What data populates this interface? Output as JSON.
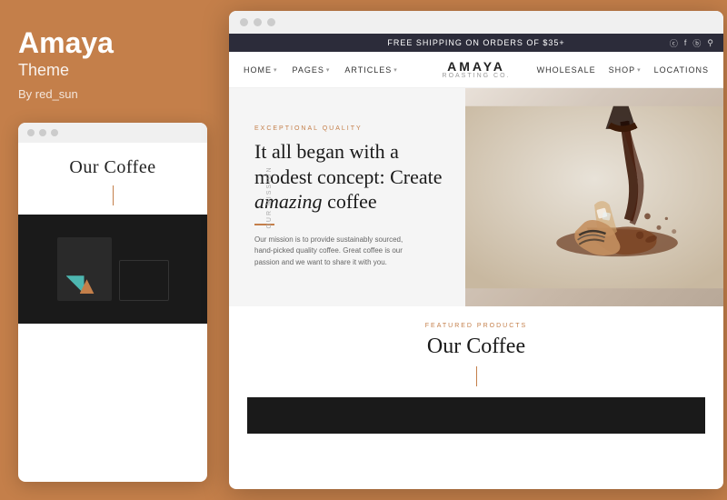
{
  "left_panel": {
    "theme_name": "Amaya",
    "theme_label": "Theme",
    "author": "By red_sun",
    "mini_preview": {
      "header_title": "Our Coffee",
      "dots": [
        "dot1",
        "dot2",
        "dot3"
      ]
    }
  },
  "browser": {
    "announcement": {
      "text": "FREE SHIPPING ON ORDERS OF $35+",
      "icons": [
        "instagram",
        "facebook",
        "pinterest",
        "search"
      ]
    },
    "nav": {
      "items_left": [
        {
          "label": "HOME",
          "has_chevron": true
        },
        {
          "label": "PAGES",
          "has_chevron": true
        },
        {
          "label": "ARTICLES",
          "has_chevron": true
        }
      ],
      "brand_name": "AMAYA",
      "brand_tagline": "ROASTING CO.",
      "items_right": [
        {
          "label": "WHOLESALE",
          "has_chevron": false
        },
        {
          "label": "SHOP",
          "has_chevron": true
        },
        {
          "label": "LOCATIONS",
          "has_chevron": false
        }
      ]
    },
    "hero": {
      "mission_label": "OUR MISSION",
      "quality_tag": "EXCEPTIONAL QUALITY",
      "title_part1": "It all began with a modest concept: Create ",
      "title_italic": "amazing",
      "title_part2": " coffee",
      "description": "Our mission is to provide sustainably sourced, hand-picked quality coffee. Great coffee is our passion and we want to share it with you."
    },
    "featured": {
      "tag": "FEATURED PRODUCTS",
      "title": "Our Coffee"
    }
  }
}
